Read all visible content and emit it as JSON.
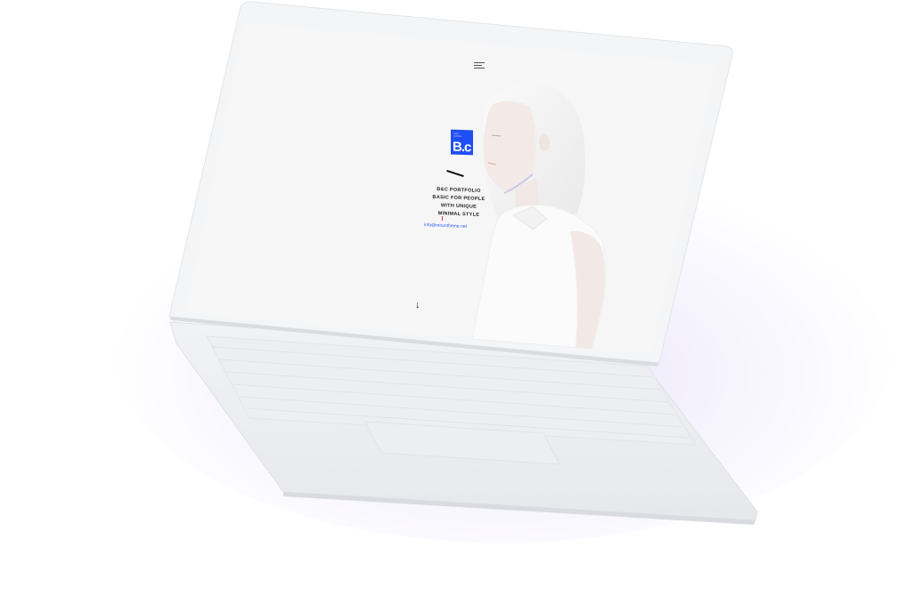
{
  "screen": {
    "menu_icon": "hamburger-menu-icon",
    "logo": {
      "small_text": "basic portfolio",
      "mark": "B.c",
      "color": "#1f4ef5"
    },
    "tagline_lines": [
      "B&C Portfolio",
      "Basic for people",
      "with unique",
      "minimal style"
    ],
    "email": "info@mountheme.net",
    "email_color": "#2a5cf5",
    "scroll_arrow": "↓",
    "scroll_arrow_icon": "arrow-down-icon",
    "hero_image": "woman-portrait-photo"
  },
  "device": {
    "type": "laptop",
    "body_color": "#eef0f3",
    "glow_color": "#e8e2fa"
  }
}
